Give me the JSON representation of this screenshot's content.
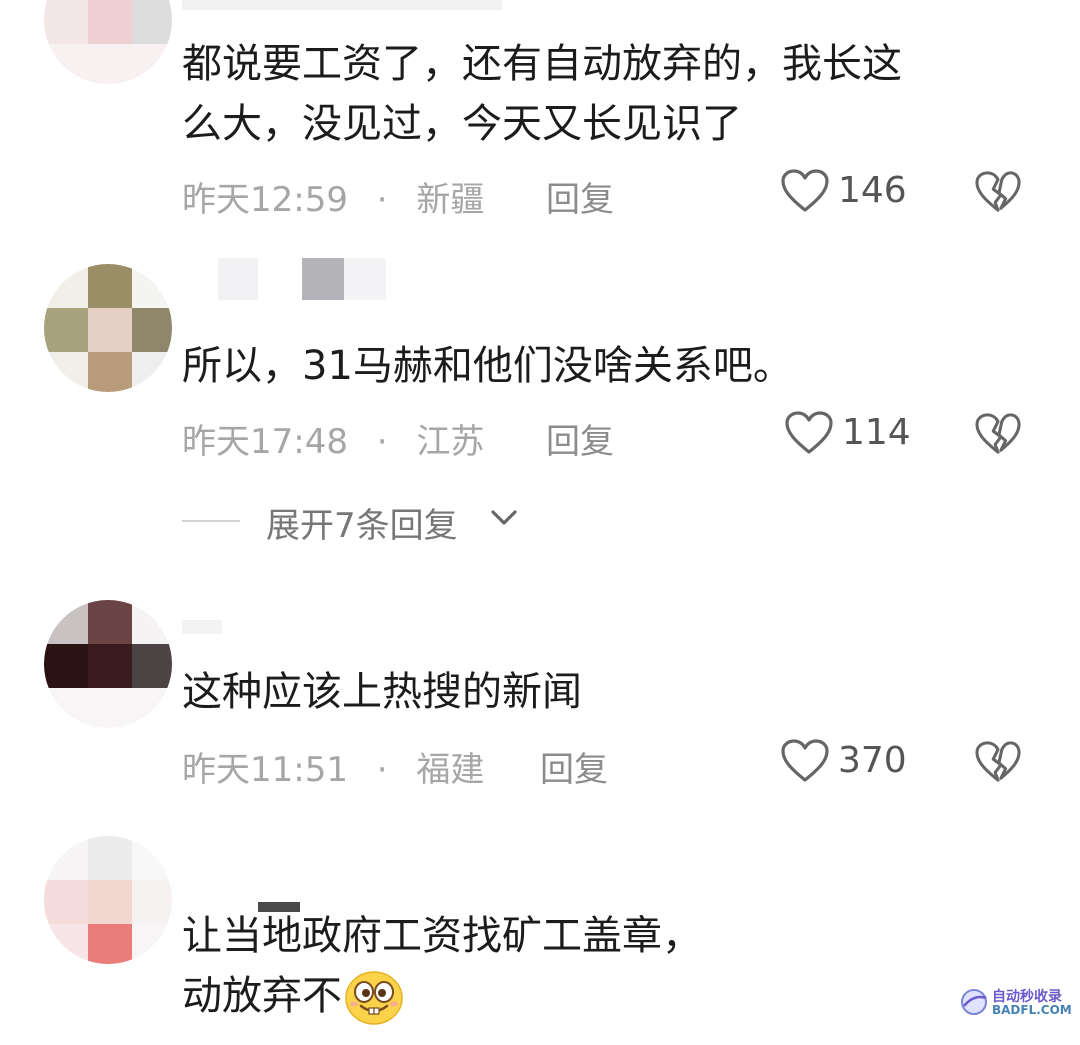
{
  "comments": [
    {
      "text_lines": [
        "都说要工资了，还有自动放弃的，我长这",
        "么大，没见过，今天又长见识了"
      ],
      "time": "昨天12:59",
      "location": "新疆",
      "reply_label": "回复",
      "likes": "146"
    },
    {
      "text_lines": [
        "所以，31马赫和他们没啥关系吧。"
      ],
      "time": "昨天17:48",
      "location": "江苏",
      "reply_label": "回复",
      "likes": "114"
    },
    {
      "text_lines": [
        "这种应该上热搜的新闻"
      ],
      "time": "昨天11:51",
      "location": "福建",
      "reply_label": "回复",
      "likes": "370"
    },
    {
      "text_lines": [
        "让当地政府工资找矿工盖章，",
        "动放弃不"
      ]
    }
  ],
  "expand_replies": "展开7条回复",
  "watermark": {
    "line1": "自动秒收录",
    "line2": "BADFL.COM"
  },
  "icons": {
    "like": "heart-outline-icon",
    "dislike": "broken-heart-icon",
    "chevron": "chevron-down-icon",
    "emoji": "grinning-emoji-icon"
  },
  "colors": {
    "text": "#1c1c1c",
    "meta": "#a6a6a6",
    "icon": "#666666"
  }
}
